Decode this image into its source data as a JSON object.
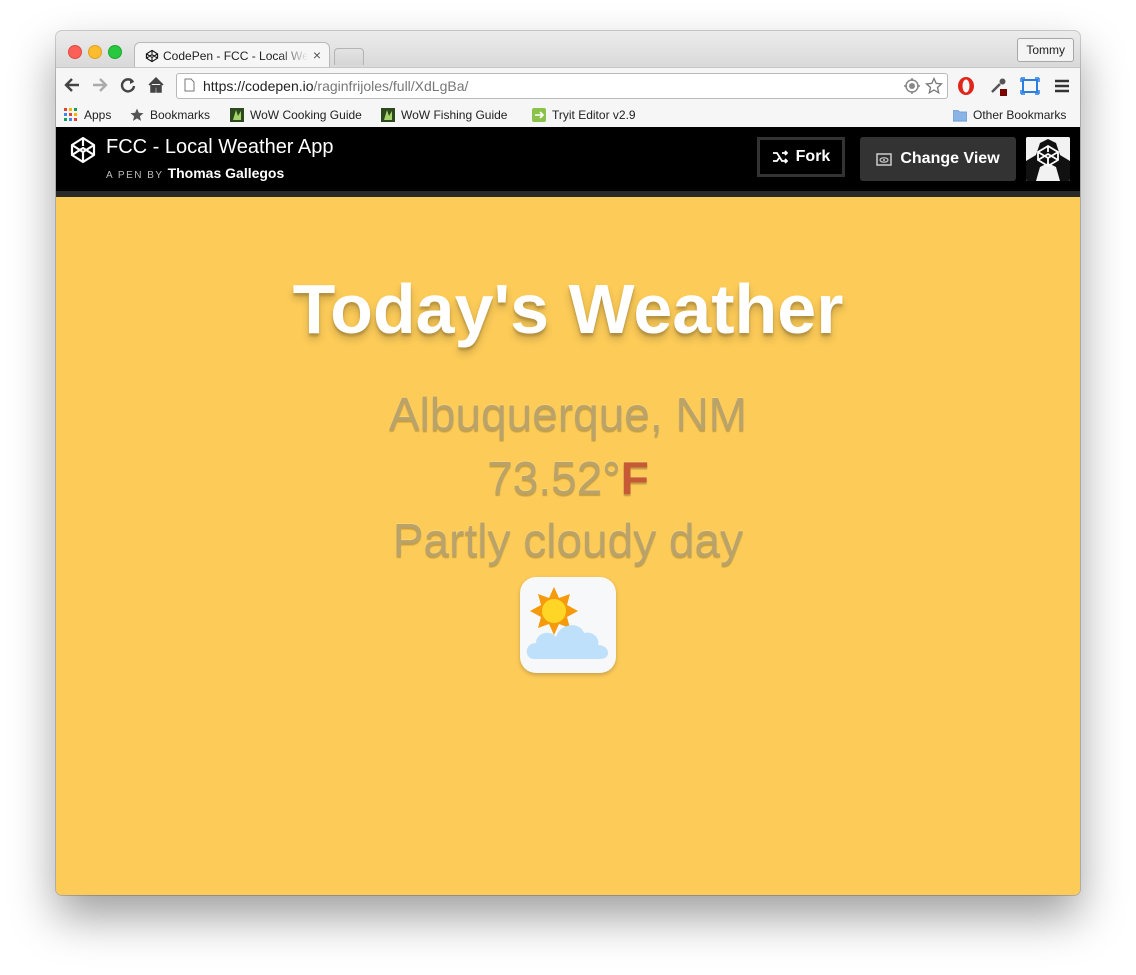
{
  "browser": {
    "tab_title": "CodePen - FCC - Local Weather App",
    "profile_name": "Tommy",
    "url_host": "https://codepen.io",
    "url_path": "/raginfrijoles/full/XdLgBa/"
  },
  "bookmarks": {
    "items": [
      {
        "label": "Apps"
      },
      {
        "label": "Bookmarks"
      },
      {
        "label": "WoW Cooking Guide"
      },
      {
        "label": "WoW Fishing Guide"
      },
      {
        "label": "Tryit Editor v2.9"
      }
    ],
    "other": "Other Bookmarks"
  },
  "codepen": {
    "pen_title": "FCC - Local Weather App",
    "byline_prefix": "A PEN BY",
    "author": "Thomas Gallegos",
    "fork_label": "Fork",
    "change_view_label": "Change View"
  },
  "weather": {
    "heading": "Today's Weather",
    "location": "Albuquerque, NM",
    "temperature": "73.52°",
    "unit": "F",
    "condition": "Partly cloudy day",
    "icon": "partly-cloudy-day-icon"
  },
  "colors": {
    "page_background": "#fccb58",
    "header_background": "#000000",
    "unit_accent": "#c65a35"
  }
}
